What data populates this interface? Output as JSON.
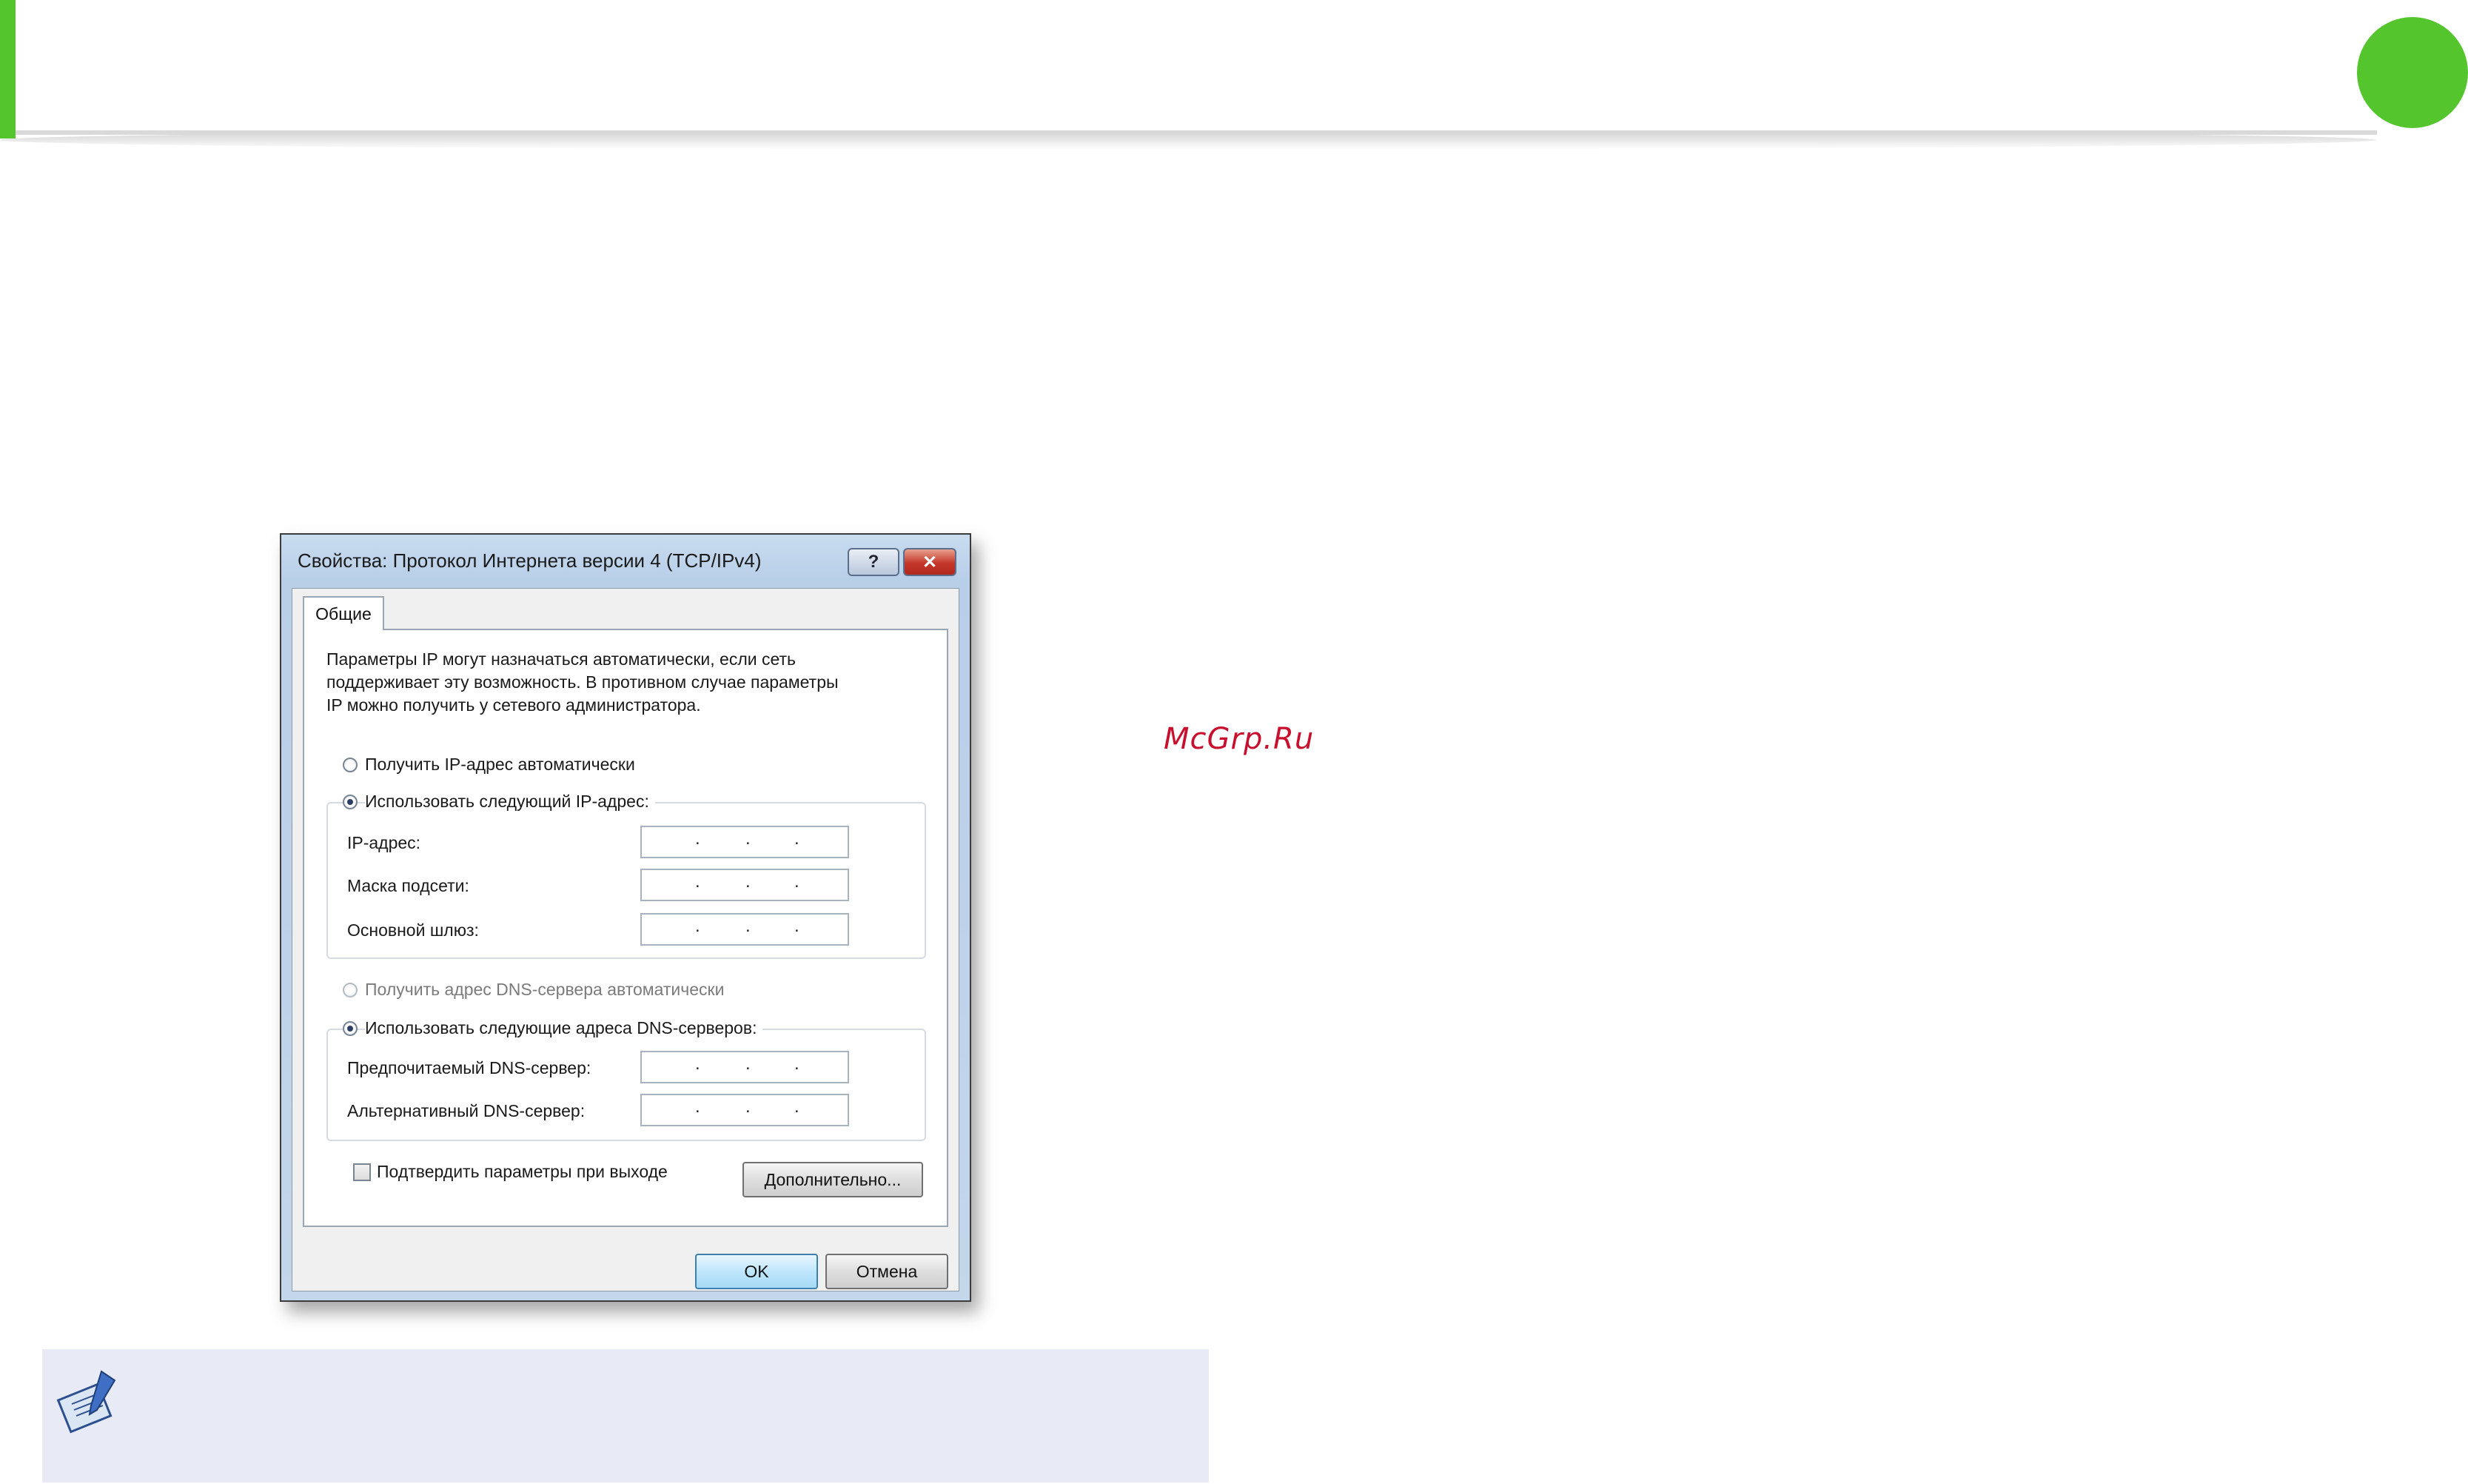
{
  "watermark": "McGrp.Ru",
  "dialog": {
    "title": "Свойства: Протокол Интернета версии 4 (TCP/IPv4)",
    "help_label": "?",
    "close_label": "✕",
    "tab_general": "Общие",
    "description_line1": "Параметры IP могут назначаться автоматически, если сеть",
    "description_line2": "поддерживает эту возможность. В противном случае параметры",
    "description_line3": "IP можно получить у сетевого администратора.",
    "ip_auto_label": "Получить IP-адрес автоматически",
    "ip_manual_label": "Использовать следующий IP-адрес:",
    "ip_mode": "manual",
    "ip_address_label": "IP-адрес:",
    "subnet_mask_label": "Маска подсети:",
    "gateway_label": "Основной шлюз:",
    "dns_auto_label": "Получить адрес DNS-сервера автоматически",
    "dns_manual_label": "Использовать следующие адреса DNS-серверов:",
    "dns_mode": "manual",
    "preferred_dns_label": "Предпочитаемый DNS-сервер:",
    "alternate_dns_label": "Альтернативный DNS-сервер:",
    "ip_dot": ".",
    "validate_label": "Подтвердить параметры при выходе",
    "validate_checked": false,
    "advanced_button": "Дополнительно...",
    "ok_button": "OK",
    "cancel_button": "Отмена"
  },
  "colors": {
    "accent_green": "#55c52e",
    "note_background": "#e8ebf6",
    "watermark_red": "#c8102e"
  },
  "icons": {
    "note": "note-pen-icon",
    "page_marker": "green-circle-icon"
  }
}
